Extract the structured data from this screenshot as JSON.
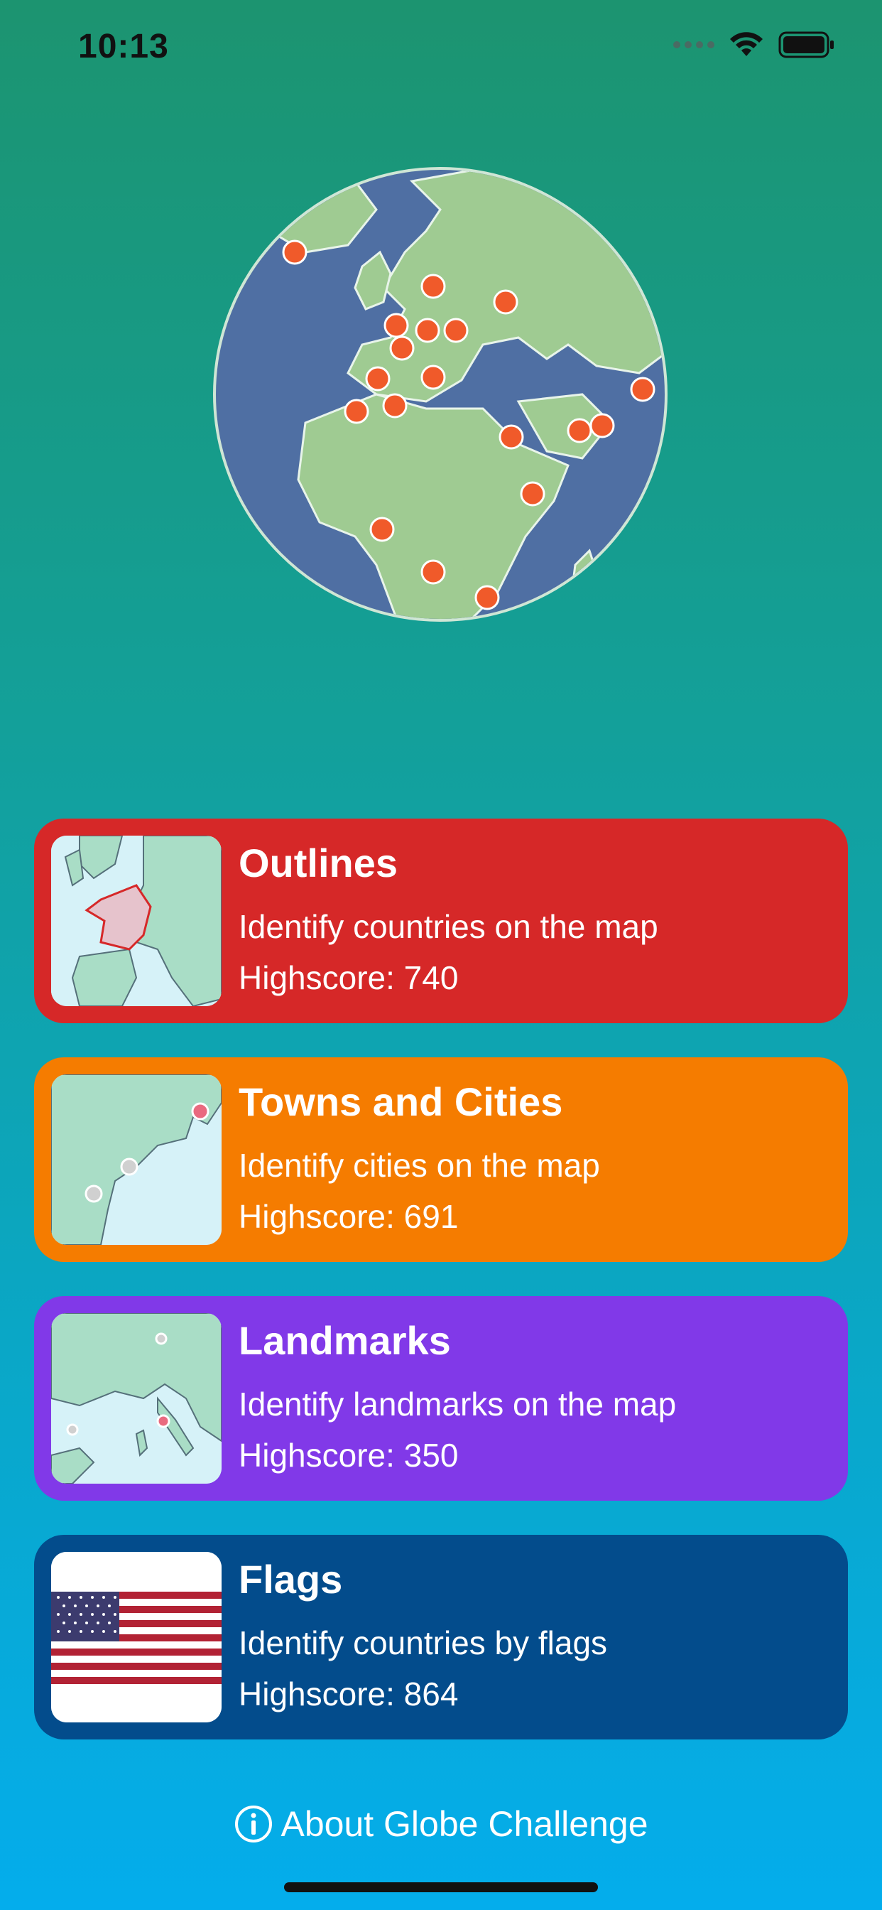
{
  "status": {
    "time": "10:13",
    "icons": [
      "signal-dots-icon",
      "wifi-icon",
      "battery-icon"
    ]
  },
  "hero": {
    "icon": "globe-icon",
    "colors": {
      "ocean": "#4f6fa3",
      "land": "#9fcb92",
      "marker": "#f05a2a"
    }
  },
  "cards": [
    {
      "title": "Outlines",
      "description": "Identify countries on the map",
      "highscore": "Highscore: 740",
      "color": "#d62828",
      "thumb": "europe-outline-map"
    },
    {
      "title": "Towns and Cities",
      "description": "Identify cities on the map",
      "highscore": "Highscore: 691",
      "color": "#f57c00",
      "thumb": "us-east-coast-map"
    },
    {
      "title": "Landmarks",
      "description": "Identify landmarks on the map",
      "highscore": "Highscore: 350",
      "color": "#8139e8",
      "thumb": "mediterranean-map"
    },
    {
      "title": "Flags",
      "description": "Identify countries by flags",
      "highscore": "Highscore: 864",
      "color": "#034c8c",
      "thumb": "us-flag"
    }
  ],
  "footer": {
    "about_label": "About Globe Challenge",
    "icon": "info-icon"
  }
}
